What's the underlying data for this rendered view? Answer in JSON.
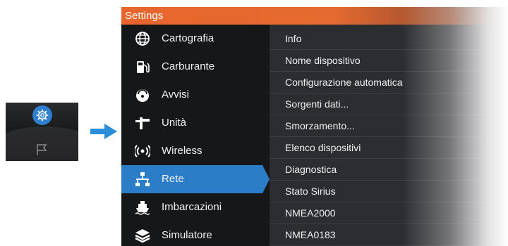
{
  "window": {
    "title": "Settings"
  },
  "sidebar": {
    "items": [
      {
        "label": "Cartografia",
        "icon": "globe-icon"
      },
      {
        "label": "Carburante",
        "icon": "fuel-pump-icon"
      },
      {
        "label": "Avvisi",
        "icon": "alarm-icon"
      },
      {
        "label": "Unità",
        "icon": "units-icon"
      },
      {
        "label": "Wireless",
        "icon": "wireless-icon"
      },
      {
        "label": "Rete",
        "icon": "network-icon",
        "selected": true
      },
      {
        "label": "Imbarcazioni",
        "icon": "vessel-icon"
      },
      {
        "label": "Simulatore",
        "icon": "layers-icon"
      }
    ]
  },
  "list": {
    "items": [
      "Info",
      "Nome dispositivo",
      "Configurazione automatica",
      "Sorgenti dati...",
      "Smorzamento...",
      "Elenco dispositivi",
      "Diagnostica",
      "Stato Sirius",
      "NMEA2000",
      "NMEA0183"
    ]
  },
  "colors": {
    "titlebar": "#e8662d",
    "selected": "#2a7dc6",
    "arrow": "#2a8fd8",
    "thumbnail_gear": "#2f7fd0"
  }
}
